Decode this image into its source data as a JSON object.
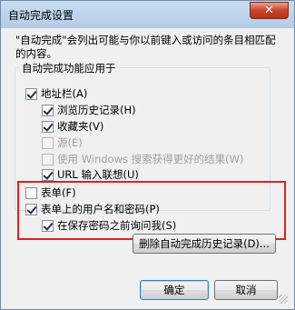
{
  "window": {
    "title": "自动完成设置",
    "close_glyph": "✕"
  },
  "description": "\"自动完成\"会列出可能与你以前键入或访问的条目相匹配的内容。",
  "group": {
    "label": "自动完成功能应用于",
    "items": [
      {
        "label": "地址栏(A)",
        "checked": true,
        "disabled": false
      },
      {
        "label": "浏览历史记录(H)",
        "checked": true,
        "disabled": false
      },
      {
        "label": "收藏夹(V)",
        "checked": true,
        "disabled": false
      },
      {
        "label": "源(E)",
        "checked": false,
        "disabled": true
      },
      {
        "label": "使用 Windows 搜索获得更好的结果(W)",
        "checked": false,
        "disabled": true
      },
      {
        "label": "URL 输入联想(U)",
        "checked": true,
        "disabled": false
      }
    ]
  },
  "forms": {
    "items": [
      {
        "label": "表单(F)",
        "checked": false
      },
      {
        "label": "表单上的用户名和密码(P)",
        "checked": true
      },
      {
        "label": "在保存密码之前询问我(S)",
        "checked": true
      }
    ]
  },
  "buttons": {
    "delete_history": "删除自动完成历史记录(D)...",
    "ok": "确定",
    "cancel": "取消"
  },
  "colors": {
    "highlight": "#e02020",
    "titlebar": "#b4cce8"
  }
}
